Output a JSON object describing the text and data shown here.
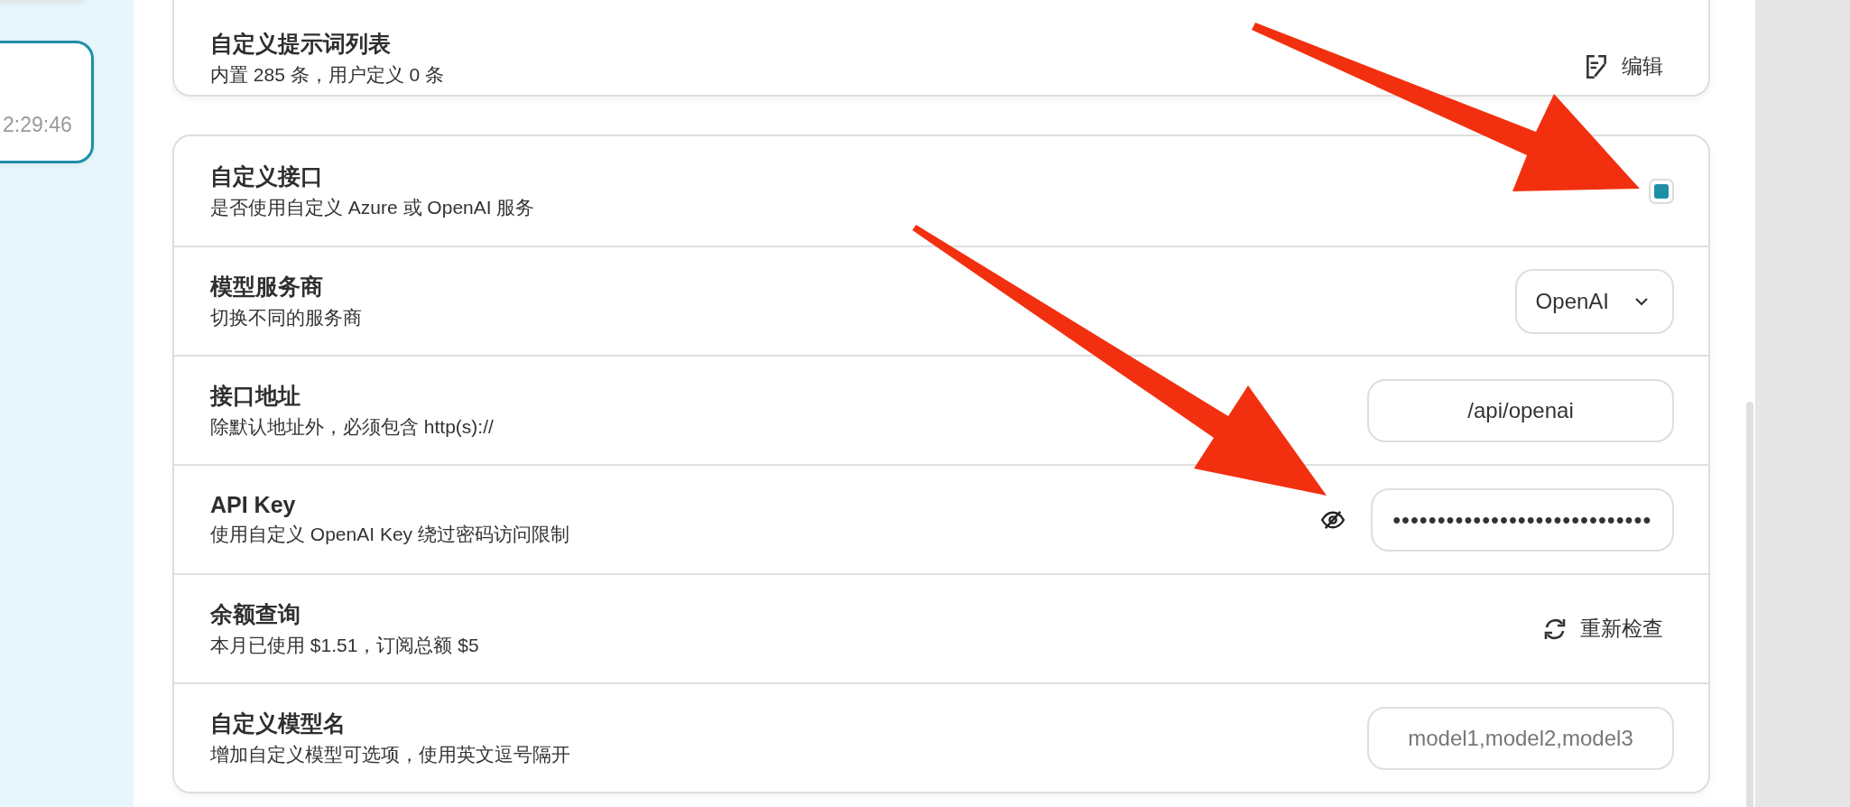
{
  "sidebar": {
    "sessions": [
      {
        "selected": false
      },
      {
        "time": "2:29:46",
        "selected": true
      }
    ]
  },
  "settings": {
    "cards": [
      {
        "rows": [
          {
            "kind": "button",
            "title": "自定义提示词列表",
            "subtitle": "内置 285 条，用户定义 0 条",
            "label": "编辑"
          }
        ]
      },
      {
        "rows": [
          {
            "kind": "checkbox",
            "title": "自定义接口",
            "subtitle": "是否使用自定义 Azure 或 OpenAI 服务",
            "checked": true
          },
          {
            "kind": "select",
            "title": "模型服务商",
            "subtitle": "切换不同的服务商",
            "value": "OpenAI"
          },
          {
            "kind": "input",
            "title": "接口地址",
            "subtitle": "除默认地址外，必须包含 http(s)://",
            "value": "/api/openai"
          },
          {
            "kind": "password",
            "title": "API Key",
            "subtitle": "使用自定义 OpenAI Key 绕过密码访问限制",
            "value": "•••••••••••••••••••••••••••••",
            "revealed": false
          },
          {
            "kind": "button",
            "title": "余额查询",
            "subtitle": "本月已使用 $1.51，订阅总额 $5",
            "label": "重新检查"
          },
          {
            "kind": "input",
            "title": "自定义模型名",
            "subtitle": "增加自定义模型可选项，使用英文逗号隔开",
            "placeholder": "model1,model2,model3"
          }
        ]
      }
    ]
  }
}
